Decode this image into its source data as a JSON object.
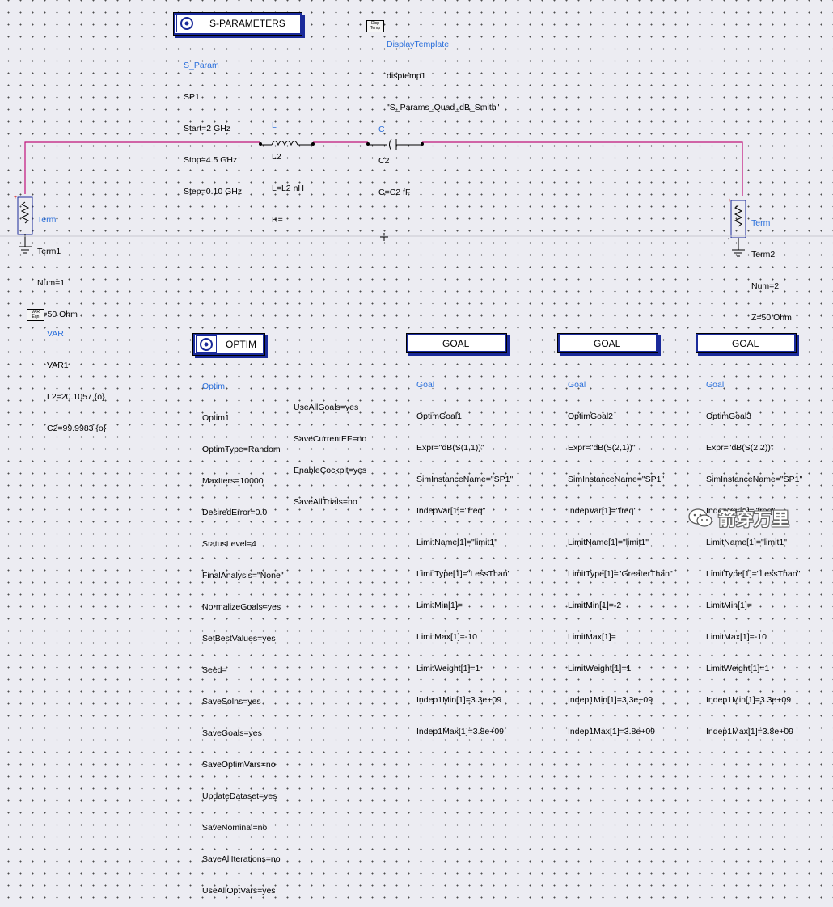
{
  "sp": {
    "title": "S-PARAMETERS",
    "lines": [
      "S_Param",
      "SP1",
      "Start=2 GHz",
      "Stop=4.5 GHz",
      "Step=0.10 GHz"
    ]
  },
  "display": {
    "icon_text": "Disp Temp",
    "lines": [
      "DisplayTemplate",
      "disptemp1",
      "\"S_Params_Quad_dB_Smith\""
    ]
  },
  "inductor": {
    "lines": [
      "L",
      "L2",
      "L=L2 nH",
      "R="
    ]
  },
  "capacitor": {
    "lines": [
      "C",
      "C2",
      "C=C2 fF"
    ]
  },
  "term1": {
    "lines": [
      "Term",
      "Term1",
      "Num=1",
      "Z=50 Ohm"
    ]
  },
  "term2": {
    "lines": [
      "Term",
      "Term2",
      "Num=2",
      "Z=50 Ohm"
    ]
  },
  "var": {
    "icon_text": "VAR Eqn",
    "lines": [
      "VAR",
      "VAR1",
      "L2=20.1057 {o}",
      "C2=99.9983 {o}"
    ]
  },
  "optim": {
    "title": "OPTIM",
    "col1": [
      "Optim",
      "Optim1",
      "OptimType=Random",
      "MaxIters=10000",
      "DesiredError=0.0",
      "StatusLevel=4",
      "FinalAnalysis=\"None\"",
      "NormalizeGoals=yes",
      "SetBestValues=yes",
      "Seed=",
      "SaveSolns=yes",
      "SaveGoals=yes",
      "SaveOptimVars=no",
      "UpdateDataset=yes",
      "SaveNominal=no",
      "SaveAllIterations=no",
      "UseAllOptVars=yes"
    ],
    "col2": [
      "UseAllGoals=yes",
      "SaveCurrentEF=no",
      "EnableCockpit=yes",
      "SaveAllTrials=no"
    ]
  },
  "goals": [
    {
      "title": "GOAL",
      "lines": [
        "Goal",
        "OptimGoal1",
        "Expr=\"dB(S(1,1))\"",
        "SimInstanceName=\"SP1\"",
        "IndepVar[1]=\"freq\"",
        "LimitName[1]=\"limit1\"",
        "LimitType[1]=\"LessThan\"",
        "LimitMin[1]=",
        "LimitMax[1]=-10",
        "LimitWeight[1]=1",
        "Indep1Min[1]=3.3e+09",
        "Indep1Max[1]=3.8e+09"
      ]
    },
    {
      "title": "GOAL",
      "lines": [
        "Goal",
        "OptimGoal2",
        "Expr=\"dB(S(2,1))\"",
        "SimInstanceName=\"SP1\"",
        "IndepVar[1]=\"freq\"",
        "LimitName[1]=\"limit1\"",
        "LimitType[1]=\"GreaterThan\"",
        "LimitMin[1]=-2",
        "LimitMax[1]=",
        "LimitWeight[1]=1",
        "Indep1Min[1]=3.3e+09",
        "Indep1Max[1]=3.8e+09"
      ]
    },
    {
      "title": "GOAL",
      "lines": [
        "Goal",
        "OptimGoal3",
        "Expr=\"dB(S(2,2))\"",
        "SimInstanceName=\"SP1\"",
        "IndepVar[1]=\"freq\"",
        "LimitName[1]=\"limit1\"",
        "LimitType[1]=\"LessThan\"",
        "LimitMin[1]=",
        "LimitMax[1]=-10",
        "LimitWeight[1]=1",
        "Indep1Min[1]=3.3e+09",
        "Indep1Max[1]=3.8e+09"
      ]
    }
  ],
  "watermark": {
    "text": "箭穿万里"
  },
  "colors": {
    "wire": "#c0127a",
    "label_blue": "#2a6fdb",
    "box_border": "#1a2a9a"
  }
}
